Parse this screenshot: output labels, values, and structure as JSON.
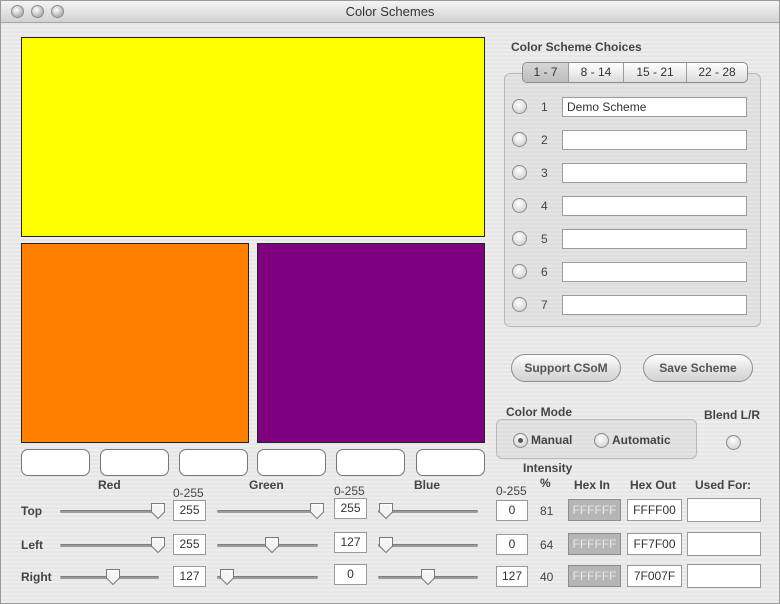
{
  "window": {
    "title": "Color Schemes"
  },
  "swatches": {
    "top_color": "#FFFF00",
    "left_color": "#FF7F00",
    "right_color": "#7F007F"
  },
  "scheme_choices": {
    "heading": "Color Scheme Choices",
    "tabs": [
      {
        "label": "1 - 7",
        "selected": true
      },
      {
        "label": "8 - 14",
        "selected": false
      },
      {
        "label": "15 - 21",
        "selected": false
      },
      {
        "label": "22 - 28",
        "selected": false
      }
    ],
    "rows": [
      {
        "num": "1",
        "name": "Demo Scheme"
      },
      {
        "num": "2",
        "name": ""
      },
      {
        "num": "3",
        "name": ""
      },
      {
        "num": "4",
        "name": ""
      },
      {
        "num": "5",
        "name": ""
      },
      {
        "num": "6",
        "name": ""
      },
      {
        "num": "7",
        "name": ""
      }
    ]
  },
  "buttons": {
    "support": "Support CSoM",
    "save": "Save Scheme"
  },
  "color_mode": {
    "label": "Color Mode",
    "manual": "Manual",
    "automatic": "Automatic",
    "selected": "manual",
    "blend_label": "Blend L/R"
  },
  "sliders": {
    "red_label": "Red",
    "green_label": "Green",
    "blue_label": "Blue",
    "range_label": "0-255",
    "intensity_label": "Intensity",
    "intensity_unit": "%",
    "hex_in_label": "Hex  In",
    "hex_out_label": "Hex  Out",
    "used_for_label": "Used For:",
    "rows": [
      {
        "label": "Top",
        "red": "255",
        "green": "255",
        "blue": "0",
        "intensity": "81",
        "hex_in": "FFFFFF",
        "hex_out": "FFFF00"
      },
      {
        "label": "Left",
        "red": "255",
        "green": "127",
        "blue": "0",
        "intensity": "64",
        "hex_in": "FFFFFF",
        "hex_out": "FF7F00"
      },
      {
        "label": "Right",
        "red": "127",
        "green": "0",
        "blue": "127",
        "intensity": "40",
        "hex_in": "FFFFFF",
        "hex_out": "7F007F"
      }
    ]
  }
}
